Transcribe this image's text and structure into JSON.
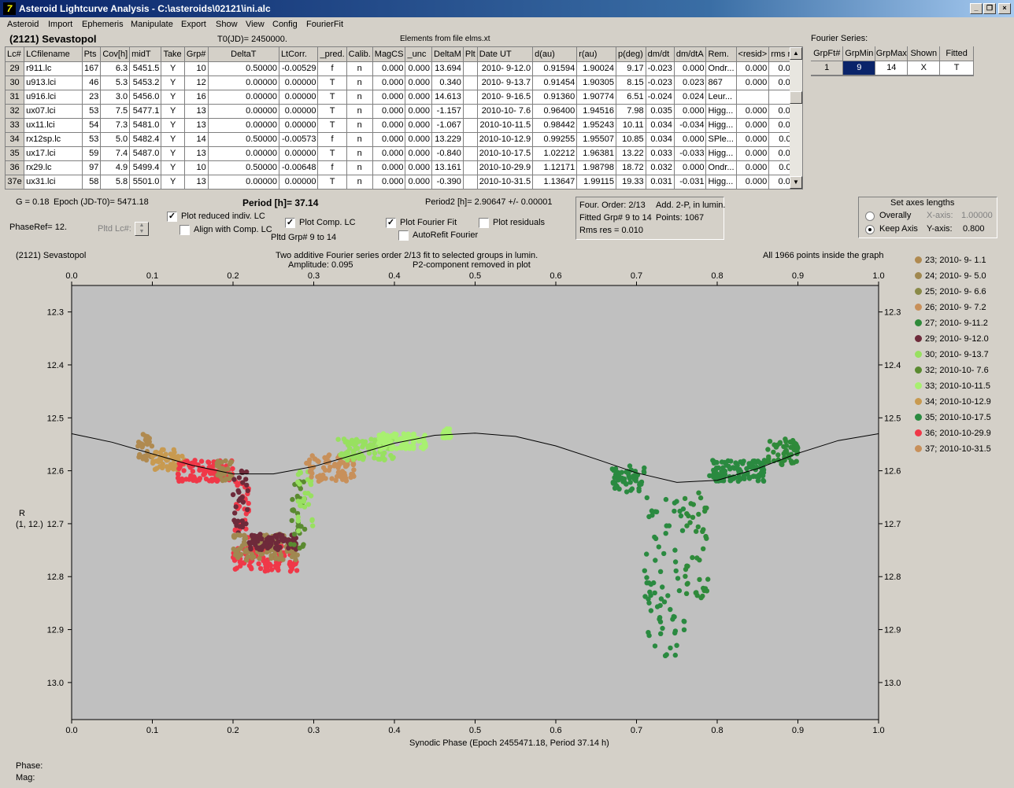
{
  "window": {
    "title": "Asteroid Lightcurve Analysis - C:\\asteroids\\02121\\ini.alc"
  },
  "menu": [
    "Asteroid",
    "Import",
    "Ephemeris",
    "Manipulate",
    "Export",
    "Show",
    "View",
    "Config",
    "FourierFit"
  ],
  "header": {
    "object": "(2121) Sevastopol",
    "t0": "T0(JD)= 2450000.",
    "elements": "Elements from file elms.xt"
  },
  "table": {
    "columns": [
      "Lc#",
      "LCfilename",
      "Pts",
      "Cov[h]",
      "midT",
      "Take",
      "Grp#",
      "DeltaT",
      "LtCorr.",
      "_pred.",
      "Calib.",
      "MagCS",
      "_unc",
      "DeltaM",
      "Plt",
      "Date UT",
      "d(au)",
      "r(au)",
      "p(deg)",
      "dm/dt",
      "dm/dtA",
      "Rem.",
      "<resid>",
      "rms res"
    ],
    "rows": [
      [
        "29",
        "r911.lc",
        "167",
        "6.3",
        "5451.5",
        "Y",
        "10",
        "0.50000",
        "-0.00529",
        "f",
        "n",
        "0.000",
        "0.000",
        "13.694",
        "",
        "2010- 9-12.0",
        "0.91594",
        "1.90024",
        "9.17",
        "-0.023",
        "0.000",
        "Ondr...",
        "0.000",
        "0.007"
      ],
      [
        "30",
        "u913.lci",
        "46",
        "5.3",
        "5453.2",
        "Y",
        "12",
        "0.00000",
        "0.00000",
        "T",
        "n",
        "0.000",
        "0.000",
        "0.340",
        "",
        "2010- 9-13.7",
        "0.91454",
        "1.90305",
        "8.15",
        "-0.023",
        "0.023",
        "867",
        "0.000",
        "0.006"
      ],
      [
        "31",
        "u916.lci",
        "23",
        "3.0",
        "5456.0",
        "Y",
        "16",
        "0.00000",
        "0.00000",
        "T",
        "n",
        "0.000",
        "0.000",
        "14.613",
        "",
        "2010- 9-16.5",
        "0.91360",
        "1.90774",
        "6.51",
        "-0.024",
        "0.024",
        "Leur...",
        "",
        ""
      ],
      [
        "32",
        "ux07.lci",
        "53",
        "7.5",
        "5477.1",
        "Y",
        "13",
        "0.00000",
        "0.00000",
        "T",
        "n",
        "0.000",
        "0.000",
        "-1.157",
        "",
        "2010-10- 7.6",
        "0.96400",
        "1.94516",
        "7.98",
        "0.035",
        "0.000",
        "Higg...",
        "0.000",
        "0.012"
      ],
      [
        "33",
        "ux11.lci",
        "54",
        "7.3",
        "5481.0",
        "Y",
        "13",
        "0.00000",
        "0.00000",
        "T",
        "n",
        "0.000",
        "0.000",
        "-1.067",
        "",
        "2010-10-11.5",
        "0.98442",
        "1.95243",
        "10.11",
        "0.034",
        "-0.034",
        "Higg...",
        "0.000",
        "0.012"
      ],
      [
        "34",
        "rx12sp.lc",
        "53",
        "5.0",
        "5482.4",
        "Y",
        "14",
        "0.50000",
        "-0.00573",
        "f",
        "n",
        "0.000",
        "0.000",
        "13.229",
        "",
        "2010-10-12.9",
        "0.99255",
        "1.95507",
        "10.85",
        "0.034",
        "0.000",
        "SPle...",
        "0.000",
        "0.011"
      ],
      [
        "35",
        "ux17.lci",
        "59",
        "7.4",
        "5487.0",
        "Y",
        "13",
        "0.00000",
        "0.00000",
        "T",
        "n",
        "0.000",
        "0.000",
        "-0.840",
        "",
        "2010-10-17.5",
        "1.02212",
        "1.96381",
        "13.22",
        "0.033",
        "-0.033",
        "Higg...",
        "0.000",
        "0.012"
      ],
      [
        "36",
        "rx29.lc",
        "97",
        "4.9",
        "5499.4",
        "Y",
        "10",
        "0.50000",
        "-0.00648",
        "f",
        "n",
        "0.000",
        "0.000",
        "13.161",
        "",
        "2010-10-29.9",
        "1.12171",
        "1.98798",
        "18.72",
        "0.032",
        "0.000",
        "Ondr...",
        "0.000",
        "0.011"
      ],
      [
        "37e",
        "ux31.lci",
        "58",
        "5.8",
        "5501.0",
        "Y",
        "13",
        "0.00000",
        "0.00000",
        "T",
        "n",
        "0.000",
        "0.000",
        "-0.390",
        "",
        "2010-10-31.5",
        "1.13647",
        "1.99115",
        "19.33",
        "0.031",
        "-0.031",
        "Higg...",
        "0.000",
        "0.010"
      ]
    ]
  },
  "fourier_series": {
    "title": "Fourier Series:",
    "columns": [
      "GrpFt#",
      "GrpMin",
      "GrpMax",
      "Shown",
      "Fitted"
    ],
    "row": [
      "1",
      "9",
      "14",
      "X",
      "T"
    ]
  },
  "info": {
    "g": "G = 0.18",
    "epoch": "Epoch (JD-T0)= 5471.18",
    "period": "Period [h]= 37.14",
    "period2": "Period2 [h]= 2.90647 +/- 0.00001",
    "phaseref": "PhaseRef= 12.",
    "pltd_lc": "Pltd Lc#:",
    "pltd_grp": "Pltd Grp#  9  to  14"
  },
  "checkboxes": {
    "reduced": {
      "label": "Plot reduced indiv. LC",
      "checked": "✓"
    },
    "align": {
      "label": "Align with Comp. LC",
      "checked": ""
    },
    "comp": {
      "label": "Plot Comp. LC",
      "checked": "✓"
    },
    "fourier": {
      "label": "Plot Fourier Fit",
      "checked": "✓"
    },
    "residuals": {
      "label": "Plot residuals",
      "checked": ""
    },
    "autorefit": {
      "label": "AutoRefit Fourier",
      "checked": ""
    }
  },
  "fit_box": {
    "line1a": "Four. Order:  2/13",
    "line1b": "Add. 2-P, in lumin.",
    "line2a": "Fitted Grp# 9 to 14",
    "line2b": "Points: 1067",
    "line3": "Rms res     = 0.010"
  },
  "axes_box": {
    "title": "Set axes lengths",
    "overally": "Overally",
    "keep": "Keep Axis",
    "xlabel": "X-axis:",
    "xval": "1.00000",
    "ylabel": "Y-axis:",
    "yval": "0.800"
  },
  "plot": {
    "object": "(2121) Sevastopol",
    "line1": "Two additive Fourier series order 2/13 fit to selected groups in lumin.",
    "line2a": "Amplitude: 0.095",
    "line2b": "P2-component removed in plot",
    "points_note": "All 1966 points inside the graph",
    "ylabel1": "R",
    "ylabel2": "(1, 12.)",
    "xaxis_label": "Synodic Phase (Epoch 2455471.18, Period 37.14 h)"
  },
  "chart_data": {
    "type": "scatter",
    "xlabel": "Synodic Phase (Epoch 2455471.18, Period 37.14 h)",
    "ylabel": "R",
    "xlim": [
      0.0,
      1.0
    ],
    "ylim": [
      12.25,
      13.07
    ],
    "y_inverted": true,
    "x_ticks": [
      "0.0",
      "0.1",
      "0.2",
      "0.3",
      "0.4",
      "0.5",
      "0.6",
      "0.7",
      "0.8",
      "0.9",
      "1.0"
    ],
    "y_ticks": [
      "12.3",
      "12.4",
      "12.5",
      "12.6",
      "12.7",
      "12.8",
      "12.9",
      "13.0"
    ],
    "legend_position": "right",
    "grid": false,
    "fourier_fit": {
      "x": [
        0.0,
        0.05,
        0.1,
        0.15,
        0.2,
        0.25,
        0.3,
        0.35,
        0.4,
        0.45,
        0.5,
        0.55,
        0.6,
        0.65,
        0.7,
        0.75,
        0.8,
        0.85,
        0.9,
        0.95,
        1.0
      ],
      "y": [
        12.53,
        12.546,
        12.568,
        12.59,
        12.606,
        12.606,
        12.592,
        12.57,
        12.548,
        12.533,
        12.529,
        12.535,
        12.553,
        12.578,
        12.604,
        12.622,
        12.618,
        12.596,
        12.567,
        12.543,
        12.53
      ]
    },
    "series": [
      {
        "name": "23; 2010- 9- 1.1",
        "color": "#b08a50"
      },
      {
        "name": "24; 2010- 9- 5.0",
        "color": "#a08850"
      },
      {
        "name": "25; 2010- 9- 6.6",
        "color": "#8a8a48"
      },
      {
        "name": "26; 2010- 9- 7.2",
        "color": "#c8905a"
      },
      {
        "name": "27; 2010- 9-11.2",
        "color": "#2f8a3a"
      },
      {
        "name": "29; 2010- 9-12.0",
        "color": "#6e2a3a"
      },
      {
        "name": "30; 2010- 9-13.7",
        "color": "#98e060"
      },
      {
        "name": "32; 2010-10- 7.6",
        "color": "#5a8a30"
      },
      {
        "name": "33; 2010-10-11.5",
        "color": "#a8f070"
      },
      {
        "name": "34; 2010-10-12.9",
        "color": "#c89a50"
      },
      {
        "name": "35; 2010-10-17.5",
        "color": "#2a8a40"
      },
      {
        "name": "36; 2010-10-29.9",
        "color": "#f03848"
      },
      {
        "name": "37; 2010-10-31.5",
        "color": "#c8905a"
      }
    ],
    "point_clusters": [
      {
        "series": 0,
        "x": [
          0.08,
          0.1
        ],
        "y": [
          12.53,
          12.58
        ]
      },
      {
        "series": 9,
        "x": [
          0.1,
          0.14
        ],
        "y": [
          12.56,
          12.6
        ]
      },
      {
        "series": 11,
        "x": [
          0.13,
          0.2
        ],
        "y": [
          12.58,
          12.62
        ]
      },
      {
        "series": 1,
        "x": [
          0.18,
          0.2
        ],
        "y": [
          12.58,
          12.62
        ]
      },
      {
        "series": 11,
        "x": [
          0.2,
          0.22
        ],
        "y": [
          12.62,
          12.73
        ]
      },
      {
        "series": 5,
        "x": [
          0.2,
          0.22
        ],
        "y": [
          12.6,
          12.72
        ]
      },
      {
        "series": 11,
        "x": [
          0.2,
          0.28
        ],
        "y": [
          12.74,
          12.79
        ]
      },
      {
        "series": 1,
        "x": [
          0.2,
          0.28
        ],
        "y": [
          12.72,
          12.77
        ]
      },
      {
        "series": 5,
        "x": [
          0.22,
          0.28
        ],
        "y": [
          12.72,
          12.75
        ]
      },
      {
        "series": 7,
        "x": [
          0.27,
          0.29
        ],
        "y": [
          12.62,
          12.75
        ]
      },
      {
        "series": 6,
        "x": [
          0.28,
          0.3
        ],
        "y": [
          12.6,
          12.72
        ]
      },
      {
        "series": 3,
        "x": [
          0.29,
          0.35
        ],
        "y": [
          12.57,
          12.62
        ]
      },
      {
        "series": 6,
        "x": [
          0.33,
          0.4
        ],
        "y": [
          12.54,
          12.58
        ]
      },
      {
        "series": 8,
        "x": [
          0.38,
          0.44
        ],
        "y": [
          12.53,
          12.56
        ]
      },
      {
        "series": 8,
        "x": [
          0.46,
          0.47
        ],
        "y": [
          12.52,
          12.54
        ]
      },
      {
        "series": 10,
        "x": [
          0.67,
          0.71
        ],
        "y": [
          12.59,
          12.64
        ]
      },
      {
        "series": 10,
        "x": [
          0.71,
          0.76
        ],
        "y": [
          12.65,
          12.95
        ]
      },
      {
        "series": 4,
        "x": [
          0.76,
          0.79
        ],
        "y": [
          12.64,
          12.84
        ]
      },
      {
        "series": 10,
        "x": [
          0.79,
          0.86
        ],
        "y": [
          12.58,
          12.62
        ]
      },
      {
        "series": 4,
        "x": [
          0.86,
          0.9
        ],
        "y": [
          12.54,
          12.59
        ]
      }
    ]
  }
}
